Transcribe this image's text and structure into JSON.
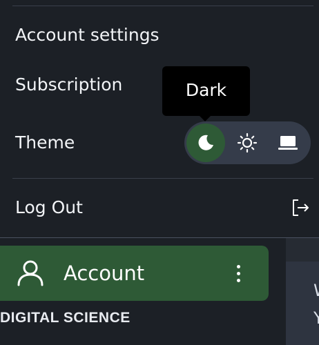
{
  "menu": {
    "account_settings": "Account settings",
    "subscription": "Subscription",
    "theme_label": "Theme",
    "log_out": "Log Out",
    "theme_options": [
      {
        "name": "moon-icon",
        "selected": true
      },
      {
        "name": "sun-icon",
        "selected": false
      },
      {
        "name": "laptop-icon",
        "selected": false
      }
    ],
    "tooltip": "Dark"
  },
  "sidebar": {
    "account_label": "Account",
    "section_heading": "DIGITAL SCIENCE"
  },
  "page": {
    "line1": "W",
    "line2": "Y"
  },
  "colors": {
    "background": "#1c2026",
    "accent_green": "#2e5a36",
    "toggle_bg": "#353c4a",
    "tooltip_bg": "#000000"
  }
}
